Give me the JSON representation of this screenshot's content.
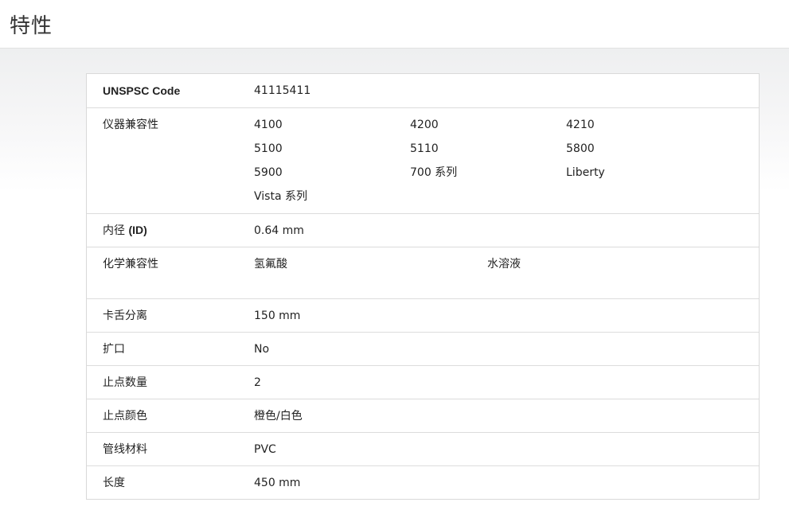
{
  "page_title": "特性",
  "rows": {
    "unspsc": {
      "label": "UNSPSC Code",
      "value": "41115411"
    },
    "instruments": {
      "label": "仪器兼容性",
      "values": [
        "4100",
        "4200",
        "4210",
        "5100",
        "5110",
        "5800",
        "5900",
        "700 系列",
        "Liberty",
        "Vista 系列"
      ]
    },
    "inner_diameter": {
      "label_prefix": "内径 ",
      "label_bold": "(ID)",
      "value": "0.64 mm"
    },
    "chemical": {
      "label": "化学兼容性",
      "values": [
        "氢氟酸",
        "水溶液"
      ]
    },
    "tongue_separation": {
      "label": "卡舌分离",
      "value": "150 mm"
    },
    "flared": {
      "label": "扩口",
      "value": "No"
    },
    "stop_count": {
      "label": "止点数量",
      "value": "2"
    },
    "stop_color": {
      "label": "止点颜色",
      "value": "橙色/白色"
    },
    "tube_material": {
      "label": "管线材料",
      "value": "PVC"
    },
    "length": {
      "label": "长度",
      "value": "450 mm"
    }
  }
}
